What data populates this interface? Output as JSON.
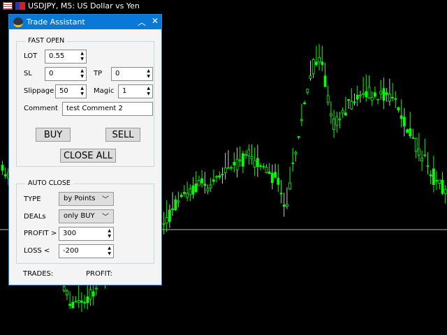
{
  "chart": {
    "title": "USDJPY, M5:  US Dollar vs Yen",
    "colors": {
      "candle": "#00ff00",
      "bid_line": "#c0c0c0"
    }
  },
  "panel": {
    "title": "Trade Assistant",
    "fast_open": {
      "label": "FAST OPEN",
      "lot_label": "LOT",
      "lot": "0.55",
      "sl_label": "SL",
      "sl": "0",
      "tp_label": "TP",
      "tp": "0",
      "slippage_label": "Slippage",
      "slippage": "50",
      "magic_label": "Magic",
      "magic": "1",
      "comment_label": "Comment",
      "comment": "test Comment 2",
      "buy": "BUY",
      "sell": "SELL",
      "close_all": "CLOSE ALL"
    },
    "auto_close": {
      "label": "AUTO CLOSE",
      "type_label": "TYPE",
      "type": "by Points",
      "deals_label": "DEALs",
      "deals": "only BUY",
      "profit_label": "PROFIT >",
      "profit": "300",
      "loss_label": "LOSS <",
      "loss": "-200"
    },
    "trades_label": "TRADES:",
    "profit_label": "PROFIT:"
  }
}
